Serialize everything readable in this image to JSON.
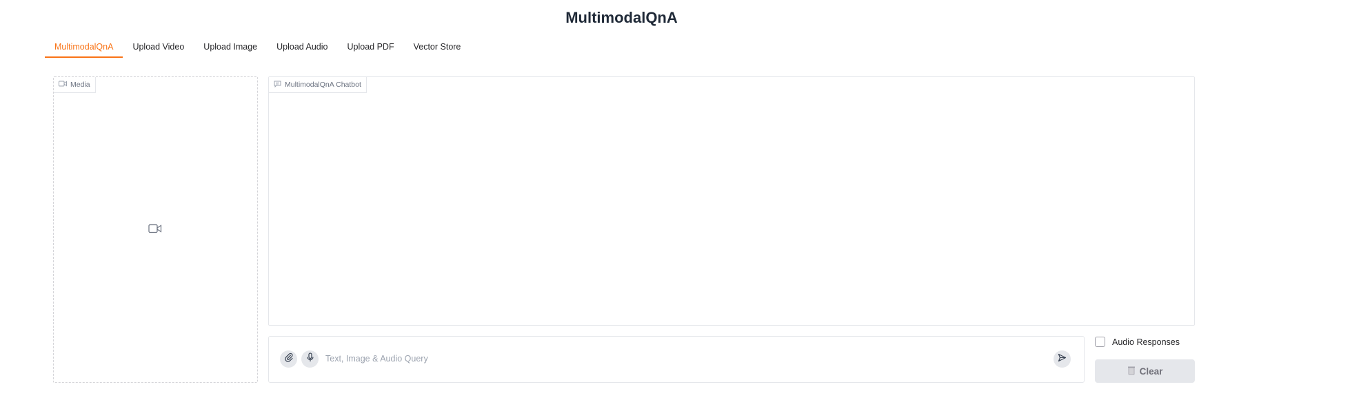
{
  "app": {
    "title": "MultimodalQnA"
  },
  "tabs": [
    {
      "label": "MultimodalQnA",
      "active": true
    },
    {
      "label": "Upload Video",
      "active": false
    },
    {
      "label": "Upload Image",
      "active": false
    },
    {
      "label": "Upload Audio",
      "active": false
    },
    {
      "label": "Upload PDF",
      "active": false
    },
    {
      "label": "Vector Store",
      "active": false
    }
  ],
  "media": {
    "label": "Media",
    "icon": "video-camera-icon"
  },
  "chatbot": {
    "label": "MultimodalQnA Chatbot",
    "icon": "chat-bubble-icon"
  },
  "query": {
    "value": "",
    "placeholder": "Text, Image & Audio Query",
    "attach_icon": "paperclip-icon",
    "mic_icon": "microphone-icon",
    "submit_icon": "send-icon"
  },
  "options": {
    "audio_responses_label": "Audio Responses",
    "audio_responses_checked": false
  },
  "actions": {
    "clear_label": "Clear",
    "clear_icon": "trash-icon"
  },
  "colors": {
    "accent": "#f97316",
    "border": "#e5e7eb",
    "button_bg": "#e5e7eb"
  }
}
